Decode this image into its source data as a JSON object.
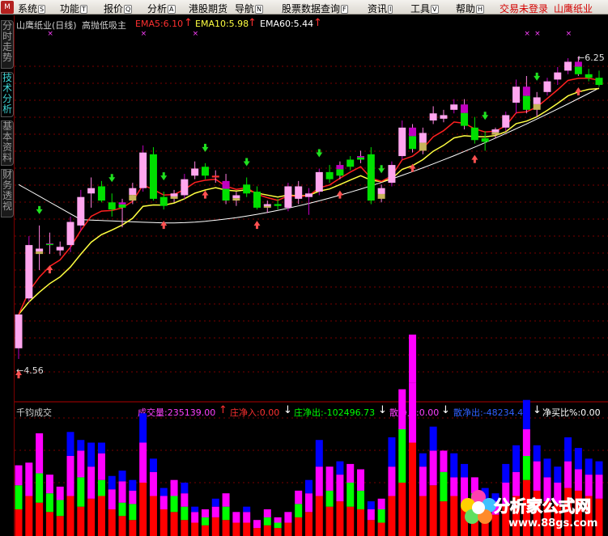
{
  "menubar": {
    "logo": "M",
    "items": [
      {
        "label": "系统",
        "key": "S"
      },
      {
        "label": "功能",
        "key": "T"
      },
      {
        "label": "报价",
        "key": "Q"
      },
      {
        "label": "分析",
        "key": "A"
      },
      {
        "label": "港股期货",
        "key": ""
      },
      {
        "label": "导航",
        "key": "N"
      },
      {
        "label": "股票数据查询",
        "key": "F"
      },
      {
        "label": "资讯",
        "key": "I"
      },
      {
        "label": "工具",
        "key": "V"
      },
      {
        "label": "帮助",
        "key": "H"
      }
    ],
    "status_not_logged_in": "交易未登录",
    "stock_name": "山鹰纸业"
  },
  "sidetabs": [
    "分时走势",
    "技术分析",
    "基本资料",
    "财务透视"
  ],
  "active_tab": 1,
  "chart_header": {
    "title": "山鹰纸业(日线)",
    "indicator": "高抛低吸主",
    "ema5": "EMA5:6.10",
    "ema10": "EMA10:5.98",
    "ema60": "EMA60:5.44"
  },
  "price_labels": {
    "high": "6.25",
    "low": "4.56"
  },
  "volume_header": {
    "name": "千钧成交",
    "volume": "成交量:235139.00",
    "zhuang_in": "庄净入:0.00",
    "zhuang_out": "庄净出:-102496.73",
    "san_in": "散净入:0.00",
    "san_out": "散净出:-48234.42",
    "net_ratio": "净买比%:0.00"
  },
  "watermark": {
    "text": "分析家公式网",
    "url": "www.88gs.com"
  },
  "colors": {
    "up": "#ff7fe0",
    "up_body": "#ffa6ef",
    "down": "#00e000",
    "gold": "#c8b45a",
    "purple": "#c000c0",
    "ema5": "#ff2020",
    "ema10": "#ffff40",
    "ema60": "#ffffff",
    "vol_red": "#ff0000",
    "vol_green": "#00ff00",
    "vol_magenta": "#ff00ff",
    "vol_blue": "#0000ff"
  },
  "chart_data": {
    "type": "candlestick",
    "title": "山鹰纸业(日线)",
    "candles": [
      {
        "o": 4.62,
        "h": 4.81,
        "l": 4.56,
        "c": 4.81,
        "k": "up2",
        "top": 0
      },
      {
        "o": 4.9,
        "h": 5.25,
        "l": 4.88,
        "c": 5.2,
        "k": "up2",
        "top": 0
      },
      {
        "o": 5.15,
        "h": 5.31,
        "l": 5.06,
        "c": 5.18,
        "k": "gold",
        "top": 0
      },
      {
        "o": 5.21,
        "h": 5.27,
        "l": 5.15,
        "c": 5.2,
        "k": "mix",
        "top": 1
      },
      {
        "o": 5.17,
        "h": 5.22,
        "l": 5.14,
        "c": 5.19,
        "k": "up",
        "top": 0
      },
      {
        "o": 5.2,
        "h": 5.36,
        "l": 5.16,
        "c": 5.33,
        "k": "up2",
        "top": 0
      },
      {
        "o": 5.31,
        "h": 5.51,
        "l": 5.28,
        "c": 5.47,
        "k": "up2",
        "top": 0
      },
      {
        "o": 5.49,
        "h": 5.58,
        "l": 5.41,
        "c": 5.52,
        "k": "up",
        "top": 0
      },
      {
        "o": 5.53,
        "h": 5.56,
        "l": 5.44,
        "c": 5.45,
        "k": "down",
        "top": 0
      },
      {
        "o": 5.44,
        "h": 5.49,
        "l": 5.36,
        "c": 5.4,
        "k": "down",
        "top": 0
      },
      {
        "o": 5.41,
        "h": 5.46,
        "l": 5.3,
        "c": 5.44,
        "k": "mix",
        "top": 0
      },
      {
        "o": 5.45,
        "h": 5.55,
        "l": 5.43,
        "c": 5.52,
        "k": "gold",
        "top": 0
      },
      {
        "o": 5.52,
        "h": 5.76,
        "l": 5.5,
        "c": 5.72,
        "k": "up2",
        "top": 1
      },
      {
        "o": 5.71,
        "h": 5.75,
        "l": 5.45,
        "c": 5.46,
        "k": "down",
        "top": 0
      },
      {
        "o": 5.47,
        "h": 5.5,
        "l": 5.4,
        "c": 5.42,
        "k": "down",
        "top": 0
      },
      {
        "o": 5.46,
        "h": 5.51,
        "l": 5.44,
        "c": 5.49,
        "k": "gold",
        "top": 0
      },
      {
        "o": 5.48,
        "h": 5.6,
        "l": 5.46,
        "c": 5.57,
        "k": "up2",
        "top": 0
      },
      {
        "o": 5.59,
        "h": 5.67,
        "l": 5.57,
        "c": 5.63,
        "k": "up",
        "top": 1
      },
      {
        "o": 5.64,
        "h": 5.66,
        "l": 5.57,
        "c": 5.59,
        "k": "down",
        "top": 0
      },
      {
        "o": 5.59,
        "h": 5.62,
        "l": 5.55,
        "c": 5.58,
        "k": "red",
        "top": 0
      },
      {
        "o": 5.56,
        "h": 5.6,
        "l": 5.43,
        "c": 5.45,
        "k": "mix",
        "top": 0
      },
      {
        "o": 5.45,
        "h": 5.5,
        "l": 5.42,
        "c": 5.48,
        "k": "gold",
        "top": 0
      },
      {
        "o": 5.49,
        "h": 5.58,
        "l": 5.47,
        "c": 5.54,
        "k": "down",
        "top": 0
      },
      {
        "o": 5.5,
        "h": 5.53,
        "l": 5.4,
        "c": 5.41,
        "k": "down",
        "top": 0
      },
      {
        "o": 5.41,
        "h": 5.45,
        "l": 5.38,
        "c": 5.43,
        "k": "gold",
        "top": 0
      },
      {
        "o": 5.43,
        "h": 5.46,
        "l": 5.4,
        "c": 5.42,
        "k": "down",
        "top": 0
      },
      {
        "o": 5.41,
        "h": 5.55,
        "l": 5.39,
        "c": 5.53,
        "k": "up2",
        "top": 0
      },
      {
        "o": 5.53,
        "h": 5.56,
        "l": 5.43,
        "c": 5.46,
        "k": "up",
        "top": 0
      },
      {
        "o": 5.47,
        "h": 5.52,
        "l": 5.37,
        "c": 5.49,
        "k": "up2",
        "top": 0
      },
      {
        "o": 5.5,
        "h": 5.63,
        "l": 5.48,
        "c": 5.61,
        "k": "up2",
        "top": 0
      },
      {
        "o": 5.61,
        "h": 5.65,
        "l": 5.55,
        "c": 5.57,
        "k": "down",
        "top": 0
      },
      {
        "o": 5.59,
        "h": 5.67,
        "l": 5.57,
        "c": 5.65,
        "k": "mix",
        "top": 0
      },
      {
        "o": 5.64,
        "h": 5.7,
        "l": 5.62,
        "c": 5.68,
        "k": "down",
        "top": 0
      },
      {
        "o": 5.68,
        "h": 5.73,
        "l": 5.66,
        "c": 5.7,
        "k": "mix",
        "top": 0
      },
      {
        "o": 5.71,
        "h": 5.75,
        "l": 5.43,
        "c": 5.45,
        "k": "down",
        "top": 0
      },
      {
        "o": 5.46,
        "h": 5.54,
        "l": 5.44,
        "c": 5.52,
        "k": "gold",
        "top": 0
      },
      {
        "o": 5.55,
        "h": 5.67,
        "l": 5.53,
        "c": 5.65,
        "k": "up2",
        "top": 0
      },
      {
        "o": 5.7,
        "h": 5.9,
        "l": 5.68,
        "c": 5.86,
        "k": "up2",
        "top": 0
      },
      {
        "o": 5.86,
        "h": 5.88,
        "l": 5.72,
        "c": 5.74,
        "k": "mix",
        "top": 0
      },
      {
        "o": 5.73,
        "h": 5.86,
        "l": 5.71,
        "c": 5.83,
        "k": "gold",
        "top": 0
      },
      {
        "o": 5.9,
        "h": 5.98,
        "l": 5.88,
        "c": 5.94,
        "k": "up",
        "top": 0
      },
      {
        "o": 5.93,
        "h": 5.96,
        "l": 5.89,
        "c": 5.91,
        "k": "up",
        "top": 0
      },
      {
        "o": 5.96,
        "h": 6.02,
        "l": 5.94,
        "c": 5.99,
        "k": "up2",
        "top": 0
      },
      {
        "o": 5.99,
        "h": 6.02,
        "l": 5.85,
        "c": 5.87,
        "k": "mix",
        "top": 0
      },
      {
        "o": 5.86,
        "h": 5.92,
        "l": 5.77,
        "c": 5.79,
        "k": "down",
        "top": 0
      },
      {
        "o": 5.78,
        "h": 5.84,
        "l": 5.73,
        "c": 5.8,
        "k": "down",
        "top": 0
      },
      {
        "o": 5.82,
        "h": 5.86,
        "l": 5.8,
        "c": 5.85,
        "k": "gold",
        "top": 0
      },
      {
        "o": 5.86,
        "h": 5.95,
        "l": 5.84,
        "c": 5.93,
        "k": "up2",
        "top": 0
      },
      {
        "o": 6.0,
        "h": 6.13,
        "l": 5.94,
        "c": 6.09,
        "k": "up2",
        "top": 0
      },
      {
        "o": 6.09,
        "h": 6.15,
        "l": 5.94,
        "c": 5.96,
        "k": "mix",
        "top": 1
      },
      {
        "o": 5.96,
        "h": 6.06,
        "l": 5.92,
        "c": 6.03,
        "k": "gold",
        "top": 1
      },
      {
        "o": 6.06,
        "h": 6.14,
        "l": 6.04,
        "c": 6.12,
        "k": "up2",
        "top": 0
      },
      {
        "o": 6.13,
        "h": 6.2,
        "l": 6.1,
        "c": 6.17,
        "k": "up2",
        "top": 0
      },
      {
        "o": 6.18,
        "h": 6.25,
        "l": 6.16,
        "c": 6.23,
        "k": "up2",
        "top": 1
      },
      {
        "o": 6.23,
        "h": 6.26,
        "l": 6.15,
        "c": 6.16,
        "k": "mix",
        "top": 0
      },
      {
        "o": 6.16,
        "h": 6.19,
        "l": 6.12,
        "c": 6.14,
        "k": "down",
        "top": 0
      },
      {
        "o": 6.14,
        "h": 6.18,
        "l": 6.09,
        "c": 6.1,
        "k": "down",
        "top": 0
      }
    ],
    "buy_arrows": [
      0,
      3,
      14,
      18,
      23,
      31,
      38,
      44,
      54
    ],
    "sell_arrows": [
      2,
      9,
      14,
      18,
      22,
      29,
      35,
      45,
      50
    ],
    "volume": [
      [
        20,
        18,
        15,
        0
      ],
      [
        30,
        0,
        25,
        0
      ],
      [
        25,
        22,
        30,
        0
      ],
      [
        18,
        14,
        14,
        0
      ],
      [
        15,
        12,
        10,
        0
      ],
      [
        30,
        0,
        30,
        18
      ],
      [
        22,
        22,
        20,
        8
      ],
      [
        28,
        0,
        24,
        18
      ],
      [
        30,
        12,
        20,
        8
      ],
      [
        20,
        0,
        15,
        10
      ],
      [
        15,
        10,
        16,
        8
      ],
      [
        12,
        12,
        10,
        8
      ],
      [
        40,
        0,
        30,
        22
      ],
      [
        30,
        0,
        18,
        10
      ],
      [
        20,
        0,
        10,
        6
      ],
      [
        18,
        12,
        12,
        0
      ],
      [
        12,
        10,
        10,
        8
      ],
      [
        10,
        0,
        8,
        4
      ],
      [
        8,
        6,
        6,
        0
      ],
      [
        14,
        0,
        8,
        6
      ],
      [
        12,
        10,
        10,
        0
      ],
      [
        10,
        0,
        8,
        0
      ],
      [
        10,
        0,
        8,
        4
      ],
      [
        6,
        0,
        6,
        0
      ],
      [
        8,
        6,
        6,
        0
      ],
      [
        6,
        4,
        4,
        0
      ],
      [
        10,
        0,
        8,
        0
      ],
      [
        14,
        10,
        10,
        0
      ],
      [
        18,
        0,
        14,
        10
      ],
      [
        30,
        0,
        22,
        20
      ],
      [
        22,
        12,
        18,
        0
      ],
      [
        26,
        0,
        20,
        10
      ],
      [
        22,
        18,
        14,
        0
      ],
      [
        20,
        14,
        16,
        0
      ],
      [
        12,
        0,
        8,
        6
      ],
      [
        10,
        10,
        8,
        0
      ],
      [
        30,
        0,
        22,
        22
      ],
      [
        40,
        40,
        30,
        0
      ],
      [
        70,
        45,
        0,
        30
      ],
      [
        30,
        0,
        22,
        10
      ],
      [
        38,
        0,
        26,
        18
      ],
      [
        26,
        22,
        16,
        0
      ],
      [
        30,
        0,
        14,
        18
      ],
      [
        24,
        0,
        20,
        10
      ],
      [
        18,
        14,
        12,
        0
      ],
      [
        16,
        0,
        12,
        8
      ],
      [
        16,
        0,
        10,
        6
      ],
      [
        24,
        0,
        16,
        14
      ],
      [
        30,
        0,
        18,
        20
      ],
      [
        42,
        18,
        20,
        22
      ],
      [
        34,
        0,
        22,
        12
      ],
      [
        26,
        0,
        18,
        14
      ],
      [
        24,
        0,
        16,
        12
      ],
      [
        36,
        0,
        20,
        18
      ],
      [
        34,
        0,
        16,
        16
      ],
      [
        30,
        0,
        16,
        12
      ],
      [
        28,
        0,
        18,
        10
      ]
    ]
  }
}
